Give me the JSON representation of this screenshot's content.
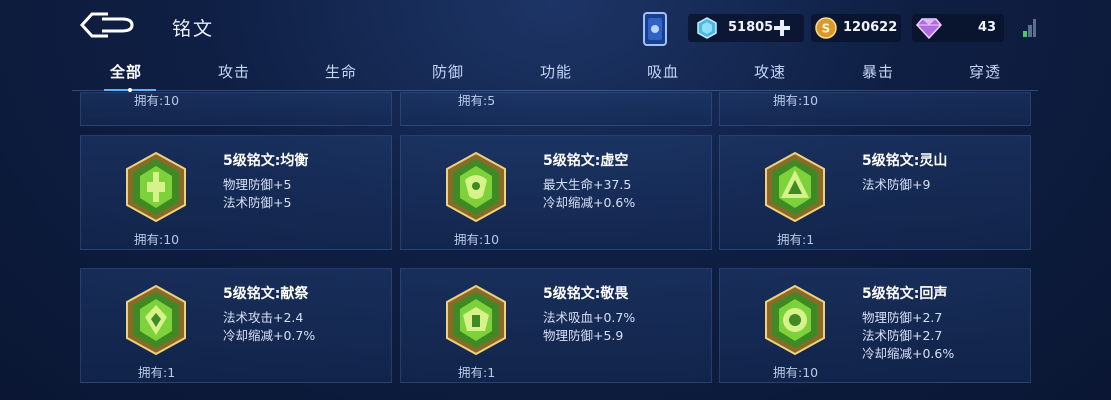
{
  "header": {
    "title": "铭文",
    "currencies": {
      "diamond": "51805",
      "gold": "120622",
      "gem": "43"
    },
    "icons": [
      "back-arrow-icon",
      "card-icon",
      "diamond-icon",
      "plus-icon",
      "gold-coin-icon",
      "gem-icon",
      "signal-icon"
    ]
  },
  "tabs": [
    "全部",
    "攻击",
    "生命",
    "防御",
    "功能",
    "吸血",
    "攻速",
    "暴击",
    "穿透"
  ],
  "active_tab": "全部",
  "partial_row": [
    "拥有:10",
    "拥有:5",
    "拥有:10"
  ],
  "runes": [
    {
      "name": "5级铭文:均衡",
      "stats": [
        "物理防御+5",
        "法术防御+5"
      ],
      "owned": "拥有:10",
      "icon": "balance-rune-icon"
    },
    {
      "name": "5级铭文:虚空",
      "stats": [
        "最大生命+37.5",
        "冷却缩减+0.6%"
      ],
      "owned": "拥有:10",
      "icon": "void-rune-icon"
    },
    {
      "name": "5级铭文:灵山",
      "stats": [
        "法术防御+9"
      ],
      "owned": "拥有:1",
      "icon": "spirit-mountain-rune-icon"
    },
    {
      "name": "5级铭文:献祭",
      "stats": [
        "法术攻击+2.4",
        "冷却缩减+0.7%"
      ],
      "owned": "拥有:1",
      "icon": "sacrifice-rune-icon"
    },
    {
      "name": "5级铭文:敬畏",
      "stats": [
        "法术吸血+0.7%",
        "物理防御+5.9"
      ],
      "owned": "拥有:1",
      "icon": "awe-rune-icon"
    },
    {
      "name": "5级铭文:回声",
      "stats": [
        "物理防御+2.7",
        "法术防御+2.7",
        "冷却缩减+0.6%"
      ],
      "owned": "拥有:10",
      "icon": "echo-rune-icon"
    }
  ],
  "colors": {
    "rune_green": "#6fbf3a",
    "rune_gold": "#c9a24a",
    "background": "#0f1f44",
    "active_tab": "#ffffff"
  }
}
